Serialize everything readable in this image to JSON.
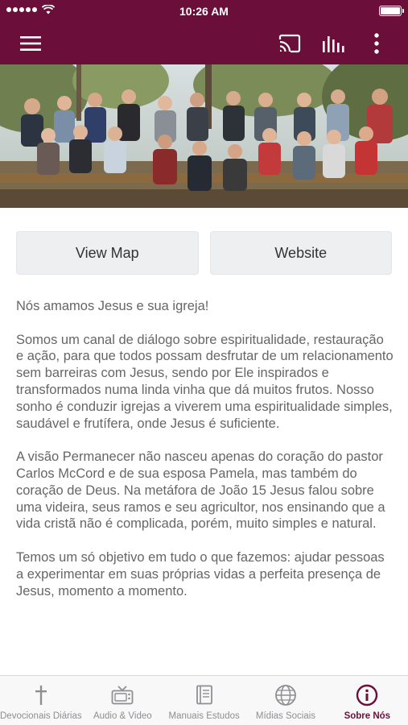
{
  "status_bar": {
    "time": "10:26 AM"
  },
  "header": {
    "accent_color": "#6b0f3a",
    "icons": [
      "menu-icon",
      "cast-icon",
      "equalizer-icon",
      "more-vertical-icon"
    ]
  },
  "actions": {
    "view_map": "View Map",
    "website": "Website"
  },
  "about": {
    "paragraphs": [
      "Nós amamos Jesus e sua igreja!",
      "Somos um canal de diálogo sobre espiritualidade, restauração e ação, para que todos possam desfrutar de um relacionamento sem barreiras com Jesus, sendo por Ele inspirados e transformados numa linda vinha que dá muitos frutos. Nosso sonho é conduzir igrejas a viverem uma espiritualidade simples, saudável e frutífera, onde Jesus é suficiente.",
      "A visão Permanecer não nasceu apenas do coração do pastor Carlos McCord e de sua esposa Pamela, mas também do coração de Deus. Na metáfora de João 15 Jesus falou sobre uma videira, seus ramos e seu agricultor, nos ensinando que a vida cristã não é complicada, porém, muito simples e natural.",
      "Temos um só objetivo em tudo o que fazemos: ajudar pessoas a experimentar em suas próprias vidas a perfeita presença de Jesus, momento a momento."
    ]
  },
  "tabs": [
    {
      "label": "Devocionais Diárias",
      "icon": "cross-icon",
      "active": false
    },
    {
      "label": "Audio & Video",
      "icon": "tv-icon",
      "active": false
    },
    {
      "label": "Manuais Estudos",
      "icon": "book-icon",
      "active": false
    },
    {
      "label": "Mídias Sociais",
      "icon": "globe-icon",
      "active": false
    },
    {
      "label": "Sobre Nós",
      "icon": "info-icon",
      "active": true
    }
  ]
}
